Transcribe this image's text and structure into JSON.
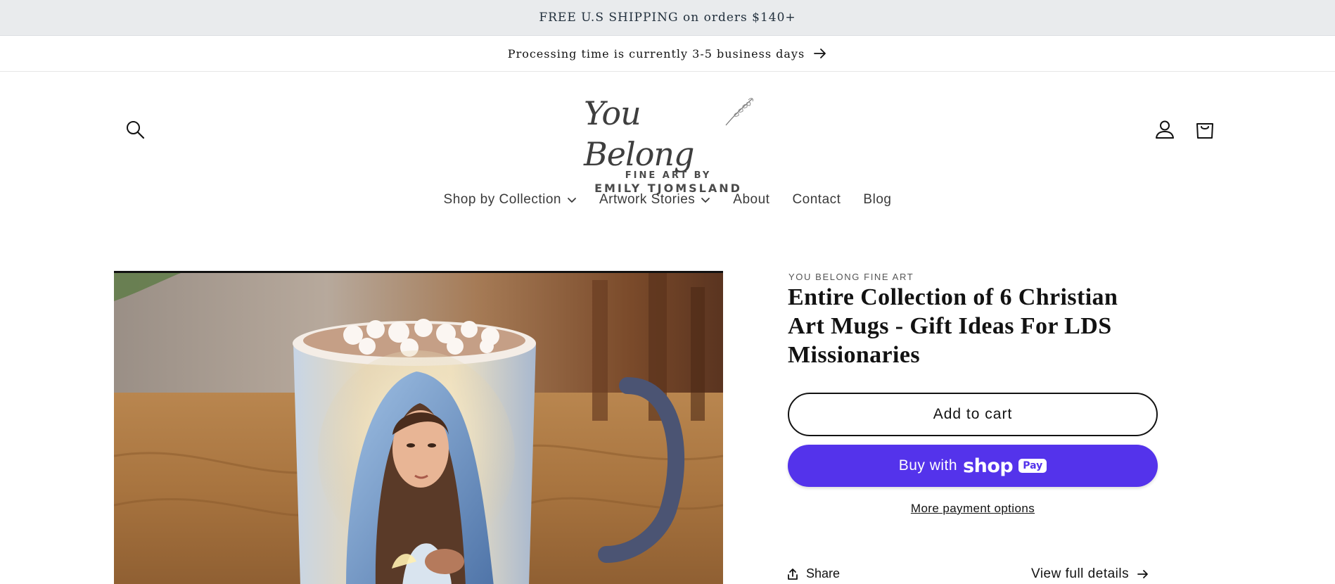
{
  "announcement": {
    "shipping": "FREE U.S SHIPPING on orders $140+",
    "processing": "Processing time is currently 3-5 business days"
  },
  "header": {
    "logo": {
      "script": "You Belong",
      "line1": "FINE ART BY",
      "line2": "EMILY TJOMSLAND"
    },
    "icons": {
      "search": "search-icon",
      "account": "account-icon",
      "cart": "cart-icon"
    }
  },
  "nav": {
    "items": [
      {
        "label": "Shop by Collection",
        "has_dropdown": true
      },
      {
        "label": "Artwork Stories",
        "has_dropdown": true
      },
      {
        "label": "About",
        "has_dropdown": false
      },
      {
        "label": "Contact",
        "has_dropdown": false
      },
      {
        "label": "Blog",
        "has_dropdown": false
      }
    ]
  },
  "product": {
    "vendor": "YOU BELONG FINE ART",
    "title": "Entire Collection of 6 Christian Art Mugs - Gift Ideas For LDS Missionaries",
    "add_to_cart": "Add to cart",
    "buy_with": "Buy with",
    "shop_word": "shop",
    "pay_badge": "Pay",
    "more_payment": "More payment options",
    "share": "Share",
    "view_details": "View full details"
  },
  "colors": {
    "announce_bg": "#e9ebed",
    "shop_pay": "#5433eb",
    "text": "#121212"
  }
}
